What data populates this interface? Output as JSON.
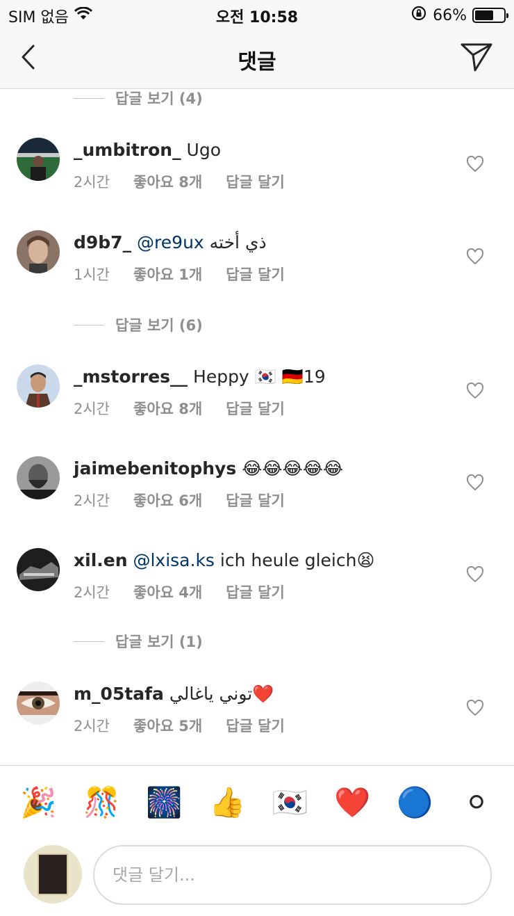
{
  "status": {
    "carrier": "SIM 없음",
    "time": "오전 10:58",
    "battery": "66%",
    "battery_level": 0.66
  },
  "nav": {
    "title": "댓글"
  },
  "view_replies": [
    "답글 보기 (4)",
    "답글 보기 (6)",
    "답글 보기 (1)"
  ],
  "comments": [
    {
      "username": "_umbitron_",
      "text": "Ugo",
      "time": "2시간",
      "likes": "좋아요 8개",
      "reply": "답글 달기"
    },
    {
      "username": "d9b7_",
      "mention": "@re9ux",
      "text": "ذي أخته",
      "time": "1시간",
      "likes": "좋아요 1개",
      "reply": "답글 달기"
    },
    {
      "username": "_mstorres__",
      "text": "Heppy 🇰🇷 🇩🇪19",
      "time": "2시간",
      "likes": "좋아요 8개",
      "reply": "답글 달기"
    },
    {
      "username": "jaimebenitophys",
      "text": "😂😂😂😂😂",
      "time": "2시간",
      "likes": "좋아요 6개",
      "reply": "답글 달기"
    },
    {
      "username": "xil.en",
      "mention": "@lxisa.ks",
      "text": "ich heule gleich😫",
      "time": "2시간",
      "likes": "좋아요 4개",
      "reply": "답글 달기"
    },
    {
      "username": "m_05tafa",
      "text": "توني ياغالي❤️",
      "time": "2시간",
      "likes": "좋아요 5개",
      "reply": "답글 달기"
    }
  ],
  "emoji_bar": [
    "🎉",
    "🎊",
    "🎆",
    "👍",
    "🇰🇷",
    "❤️",
    "🔵",
    "⚪"
  ],
  "input": {
    "placeholder": "댓글 달기..."
  },
  "colors": {
    "mention": "#003569",
    "meta": "#8e8e8e",
    "border": "#dbdbdb",
    "bar_bg": "#f7f7f7"
  }
}
